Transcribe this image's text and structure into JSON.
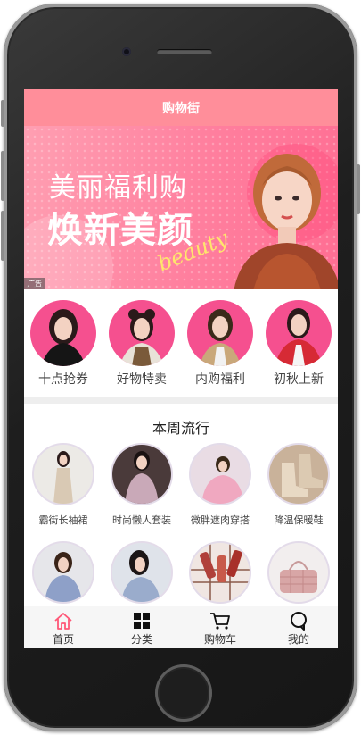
{
  "header": {
    "title": "购物街"
  },
  "banner": {
    "line1": "美丽福利购",
    "line2": "焕新美颜",
    "script": "beauty",
    "ad_label": "广告"
  },
  "quick": [
    {
      "label": "十点抢券"
    },
    {
      "label": "好物特卖"
    },
    {
      "label": "内购福利"
    },
    {
      "label": "初秋上新"
    }
  ],
  "weekly": {
    "title": "本周流行",
    "items": [
      {
        "label": "霸街长袖裙"
      },
      {
        "label": "时尚懒人套装"
      },
      {
        "label": "微胖遮肉穿搭"
      },
      {
        "label": "降温保暖鞋"
      },
      {
        "label": ""
      },
      {
        "label": ""
      },
      {
        "label": ""
      },
      {
        "label": ""
      }
    ]
  },
  "tabbar": {
    "items": [
      {
        "label": "首页",
        "icon": "home-icon",
        "active": true
      },
      {
        "label": "分类",
        "icon": "grid-icon",
        "active": false
      },
      {
        "label": "购物车",
        "icon": "cart-icon",
        "active": false
      },
      {
        "label": "我的",
        "icon": "profile-icon",
        "active": false
      }
    ]
  },
  "colors": {
    "accent": "#ff8e9a",
    "category_circle": "#f5508f",
    "active_tab_icon": "#ff5777"
  }
}
